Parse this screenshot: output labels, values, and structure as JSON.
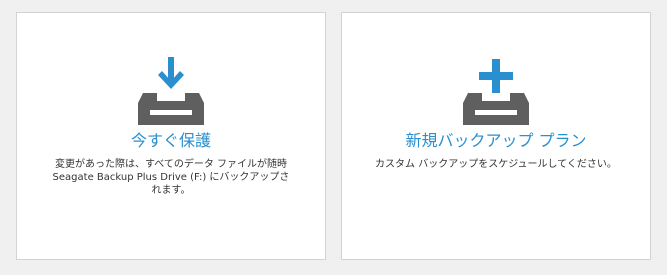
{
  "colors": {
    "background": "#f0f0f0",
    "card": "#ffffff",
    "card_border": "#d3d3d3",
    "accent": "#2a8fcf",
    "tray": "#5f5f5f",
    "text": "#333333"
  },
  "cards": [
    {
      "icon": "tray-download-icon",
      "title": "今すぐ保護",
      "description_lines": [
        "変更があった際は、すべてのデータ ファイルが随時",
        "Seagate Backup Plus Drive (F:) にバックアップさ",
        "れます。"
      ]
    },
    {
      "icon": "tray-add-icon",
      "title": "新規バックアップ プラン",
      "description_lines": [
        "カスタム バックアップをスケジュールしてください。"
      ]
    }
  ]
}
